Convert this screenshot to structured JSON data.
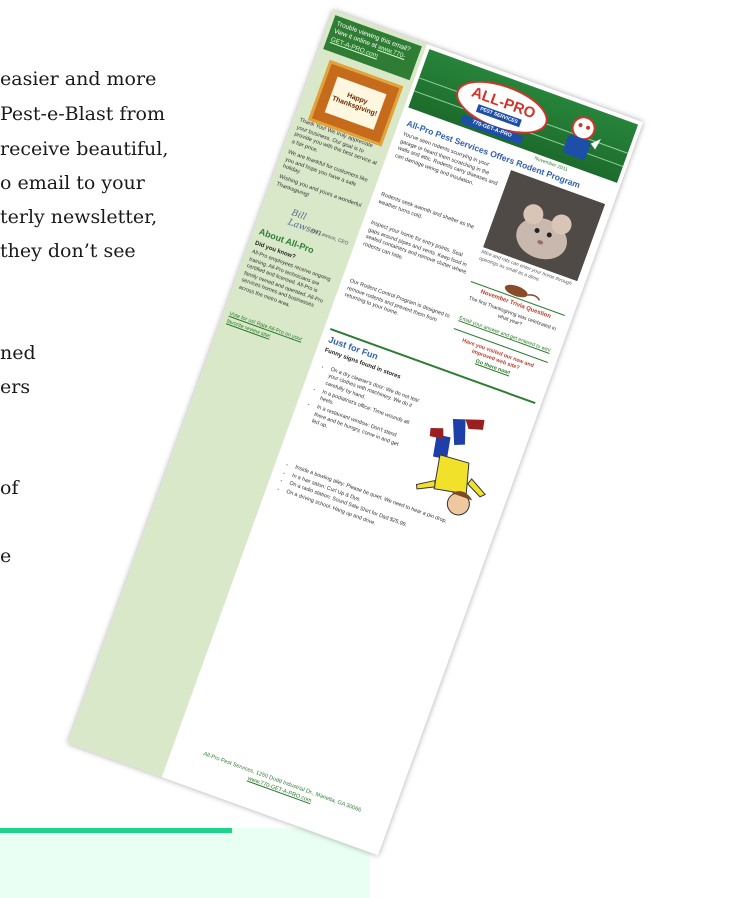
{
  "article": {
    "lines": [
      "easier and more",
      "Pest-e-Blast from",
      "receive beautiful,",
      "o email to your",
      "terly newsletter,",
      "they don’t see",
      "ned",
      "ers",
      "of",
      "e"
    ]
  },
  "newsletter": {
    "sidebar": {
      "header_text": "Trouble viewing this email? View it online at",
      "header_link": "www.770-GET-A-PRO.com",
      "card_text": "Happy Thanksgiving!",
      "intro": "Thank You! We truly appreciate your business. Our goal is to provide you with the best service at a fair price.",
      "intro2": "We are thankful for customers like you and hope you have a safe holiday.",
      "intro3": "Wishing you and yours a wonderful Thanksgiving!",
      "signature": "Bill Lawson",
      "signature_name": "Bill Lawson, CEO",
      "about_title": "About All-Pro",
      "about_question": "Did you know?",
      "about_body": "All-Pro employees receive ongoing training. All-Pro technicians are certified and licensed. All-Pro is family owned and operated. All-Pro services homes and businesses across the metro area.",
      "about_link": "Vote for us! Rate All-Pro on your favorite review site!"
    },
    "banner": {
      "logo_text": "ALL-PRO",
      "logo_sub": "PEST SERVICES",
      "phone": "770-GET-A-PRO"
    },
    "main": {
      "issue_date": "November 2011",
      "headline": "All-Pro Pest Services Offers Rodent Program",
      "body1": "You've seen rodents scurrying in your garage or heard them scratching in the walls and attic. Rodents carry diseases and can damage wiring and insulation.",
      "body2": "Rodents seek warmth and shelter as the weather turns cold.",
      "body3": "Inspect your home for entry points. Seal gaps around pipes and vents. Keep food in sealed containers and remove clutter where rodents can hide.",
      "body4": "Our Rodent Control Program is designed to remove rodents and prevent them from returning to your home.",
      "photo_caption": "Mice and rats can enter your home through openings as small as a dime.",
      "box_title": "November Trivia Question",
      "box_body": "The first Thanksgiving was celebrated in what year?",
      "box_link": "Email your answer and get entered to win!",
      "box2_text": "Have you visited our new and improved web site?",
      "box2_link": "Go there now!",
      "fun_title": "Just for Fun",
      "fun_sub": "Funny signs found in stores",
      "fun_items": [
        "On a dry cleaner's door: We do not tear your clothes with machinery. We do it carefully by hand.",
        "In a podiatrist's office: Time wounds all heels.",
        "In a restaurant window: Don't stand there and be hungry, come in and get fed up."
      ],
      "fun_items2": [
        "Inside a bowling alley: Please be quiet. We need to hear a pin drop.",
        "In a hair salon: Curl Up & Dye.",
        "On a radio station: Sound Sale Shirt for Dad $25.99.",
        "On a driving school: Hang up and drive."
      ]
    },
    "footer": {
      "address": "All-Pro Pest Services, 1250 Dodd Industrial Dr., Marietta, GA 30066",
      "link": "www.770-GET-A-PRO.com"
    }
  }
}
